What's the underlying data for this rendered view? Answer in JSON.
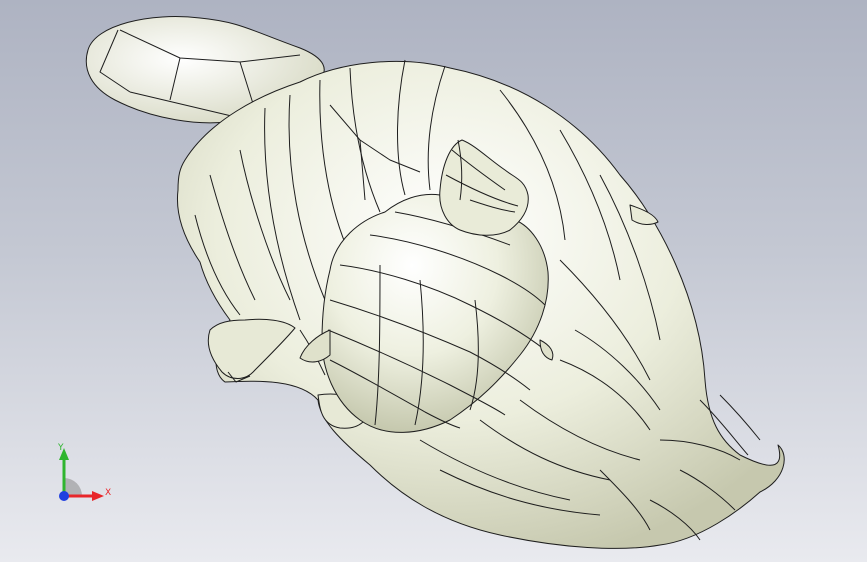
{
  "viewport": {
    "background_top": "#aeb3c2",
    "background_bottom": "#e9eaef",
    "model_fill": "#eef0df",
    "model_shadow": "#c9cbb3",
    "edge_color": "#1e1e1e"
  },
  "triad": {
    "x_label": "X",
    "y_label": "Y",
    "x_color": "#e8262a",
    "y_color": "#2fb52f",
    "z_color": "#1f3fe0"
  }
}
